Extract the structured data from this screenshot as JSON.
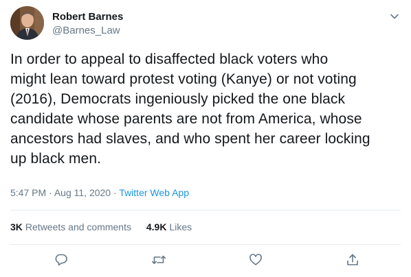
{
  "author": {
    "display_name": "Robert Barnes",
    "handle": "@Barnes_Law"
  },
  "tweet": {
    "text": "In order to appeal to disaffected black voters who\nmight lean toward protest voting (Kanye) or not voting\n(2016), Democrats ingeniously picked the one black\ncandidate whose parents are not from America, whose\nancestors had slaves, and who spent her career locking\nup black men.",
    "time": "5:47 PM",
    "separator": "·",
    "date": "Aug 11, 2020",
    "source": "Twitter Web App"
  },
  "stats": {
    "retweets_count": "3K",
    "retweets_label": "Retweets and comments",
    "likes_count": "4.9K",
    "likes_label": "Likes"
  },
  "icons": {
    "caret": "chevron-down-icon",
    "reply": "reply-icon",
    "retweet": "retweet-icon",
    "like": "heart-icon",
    "share": "share-icon"
  },
  "colors": {
    "text": "#14171a",
    "secondary": "#657786",
    "link": "#1b95e0",
    "divider": "#e6ecf0"
  }
}
